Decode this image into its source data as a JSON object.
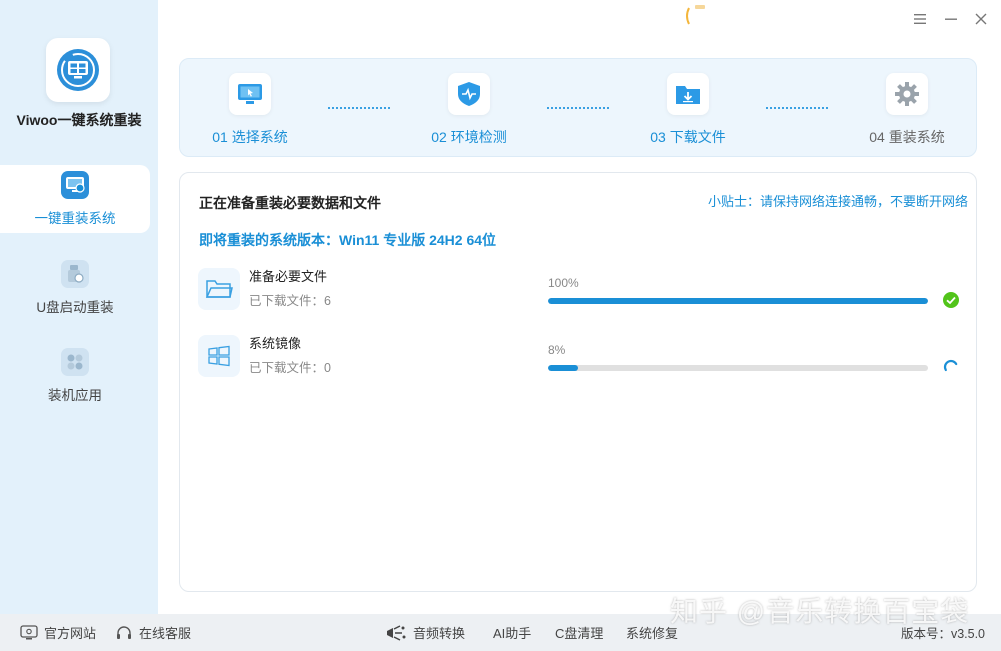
{
  "app": {
    "title": "Viwoo一键系统重装"
  },
  "sidebar": {
    "items": [
      {
        "label": "一键重装系统",
        "active": true,
        "icon": "monitor-reinstall-icon"
      },
      {
        "label": "U盘启动重装",
        "active": false,
        "icon": "usb-drive-icon"
      },
      {
        "label": "装机应用",
        "active": false,
        "icon": "apps-grid-icon"
      }
    ]
  },
  "window": {
    "minimize_icon": "minimize-icon",
    "maximize_icon": "maximize-icon",
    "close_icon": "close-icon"
  },
  "steps": [
    {
      "label": "01 选择系统",
      "icon": "select-system-icon",
      "done": true
    },
    {
      "label": "02 环境检测",
      "icon": "shield-check-icon",
      "done": true
    },
    {
      "label": "03 下载文件",
      "icon": "download-folder-icon",
      "done": true
    },
    {
      "label": "04 重装系统",
      "icon": "gear-icon",
      "done": false
    }
  ],
  "main": {
    "title": "正在准备重装必要数据和文件",
    "tip": "小贴士：请保持网络连接通畅，不要断开网络",
    "version_line": "即将重装的系统版本：Win11 专业版 24H2 64位",
    "tasks": [
      {
        "name": "准备必要文件",
        "sub": "已下载文件：6",
        "percent_text": "100%",
        "progress": 1.0,
        "status": "done",
        "icon": "folder-icon"
      },
      {
        "name": "系统镜像",
        "sub": "已下载文件：0",
        "percent_text": "8%",
        "progress": 0.08,
        "status": "loading",
        "icon": "windows-logo-icon"
      }
    ]
  },
  "footer": {
    "official_site": "官方网站",
    "online_support": "在线客服",
    "audio_convert": "音频转换",
    "ai_assistant": "AI助手",
    "c_drive_clean": "C盘清理",
    "system_repair": "系统修复",
    "version": "版本号：v3.5.0"
  },
  "watermark": "知乎 @音乐转换百宝袋",
  "colors": {
    "accent": "#1a8fd6",
    "success": "#52c41a",
    "sidebar_bg": "#e3f1fb"
  }
}
